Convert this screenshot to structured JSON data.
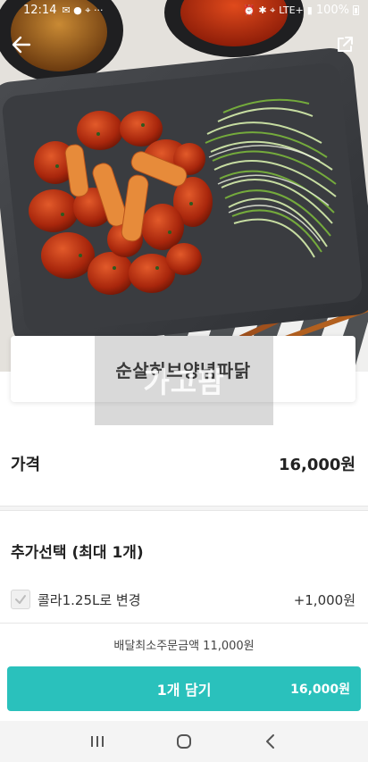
{
  "status_bar": {
    "time": "12:14",
    "battery": "100%",
    "network": "LTE+"
  },
  "nav": {
    "back_icon": "arrow-left-icon",
    "share_icon": "share-external-icon"
  },
  "menu": {
    "title": "순살허브양념파닭",
    "watermark": "가고팜"
  },
  "price": {
    "label": "가격",
    "value": "16,000원"
  },
  "options": {
    "title": "추가선택 (최대 1개)",
    "items": [
      {
        "label": "콜라1.25L로 변경",
        "price": "+1,000원",
        "checked": false
      }
    ]
  },
  "min_order": "배달최소주문금액 11,000원",
  "cart_button": {
    "label": "1개 담기",
    "total": "16,000원"
  },
  "colors": {
    "accent": "#2ac1bc",
    "text": "#222222",
    "nav_bar_bg": "#f4f4f4"
  },
  "android_nav": {
    "recents_icon": "recents-icon",
    "home_icon": "home-icon",
    "back_icon": "back-chevron-icon"
  }
}
